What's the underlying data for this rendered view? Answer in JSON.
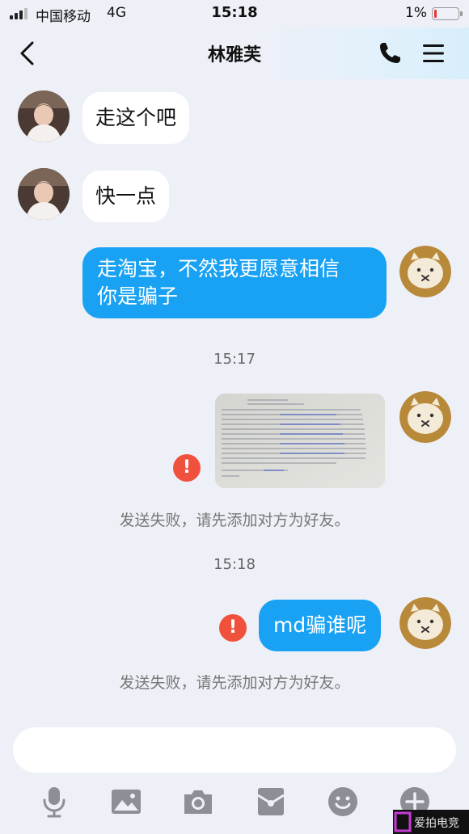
{
  "status_bar": {
    "carrier": "中国移动",
    "network": "4G",
    "time": "15:18",
    "battery_percent": "1%"
  },
  "header": {
    "title": "林雅芙",
    "icons": [
      "back-chevron-icon",
      "phone-icon",
      "menu-icon"
    ]
  },
  "messages": {
    "incoming_1": "走这个吧",
    "incoming_2": "快一点",
    "outgoing_1_line1": "走淘宝，不然我更愿意相信",
    "outgoing_1_line2": "你是骗子",
    "timestamp_1": "15:17",
    "failed_notice_1": "发送失败，请先添加对方为好友。",
    "timestamp_2": "15:18",
    "outgoing_2": "md骗谁呢",
    "failed_notice_2": "发送失败，请先添加对方为好友。",
    "error_glyph": "!"
  },
  "toolbar": {
    "icons": [
      "microphone-icon",
      "image-icon",
      "camera-icon",
      "red-packet-icon",
      "emoji-icon",
      "plus-icon"
    ]
  },
  "colors": {
    "accent": "#19a2f3",
    "error": "#f0513d",
    "background": "#eef0f7"
  },
  "watermark": {
    "text": "爱拍电竞"
  }
}
